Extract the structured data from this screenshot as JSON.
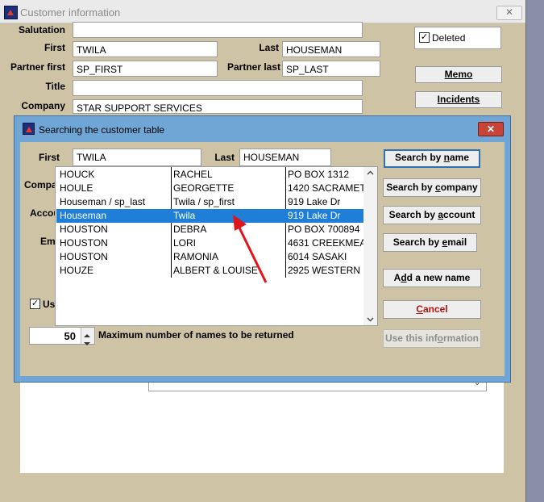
{
  "bg_window": {
    "title": "Customer information",
    "close": "✕",
    "labels": {
      "salutation": "Salutation",
      "first": "First",
      "last": "Last",
      "partner_first": "Partner first",
      "partner_last": "Partner last",
      "title": "Title",
      "company": "Company",
      "company_partial": "Compa",
      "account_partial": "Accou",
      "email_partial": "Em",
      "use_partial": "Us"
    },
    "values": {
      "salutation": "",
      "first": "TWILA",
      "last": "HOUSEMAN",
      "partner_first": "SP_FIRST",
      "partner_last": "SP_LAST",
      "title": "",
      "company": "STAR SUPPORT SERVICES"
    },
    "deleted_label": "Deleted",
    "deleted_checked": "✓",
    "memo_button": "Memo",
    "incidents_button": "Incidents"
  },
  "dialog": {
    "title": "Searching the customer table",
    "close": "✕",
    "first_label": "First",
    "first_value": "TWILA",
    "last_label": "Last",
    "last_value": "HOUSEMAN",
    "results": [
      {
        "last": "HOUCK",
        "first": "RACHEL",
        "address": "PO BOX 1312"
      },
      {
        "last": "HOULE",
        "first": "GEORGETTE",
        "address": "1420 SACRAMET"
      },
      {
        "last": "Houseman / sp_last",
        "first": "Twila / sp_first",
        "address": "919 Lake Dr"
      },
      {
        "last": "Houseman",
        "first": "Twila",
        "address": "919 Lake Dr"
      },
      {
        "last": "HOUSTON",
        "first": "DEBRA",
        "address": "PO BOX 700894"
      },
      {
        "last": "HOUSTON",
        "first": "LORI",
        "address": "4631 CREEKMEA"
      },
      {
        "last": "HOUSTON",
        "first": "RAMONIA",
        "address": "6014 SASAKI"
      },
      {
        "last": "HOUZE",
        "first": "ALBERT & LOUISE",
        "address": "2925 WESTERN"
      }
    ],
    "selected_index": 3,
    "max_names_value": "50",
    "max_names_label": "Maximum number of names to be returned",
    "use_checked": "✓",
    "buttons": {
      "search_by_name": {
        "pre": "Search by ",
        "key": "n",
        "post": "ame"
      },
      "search_by_company": {
        "pre": "Search by ",
        "key": "c",
        "post": "ompany"
      },
      "search_by_account": {
        "pre": "Search by ",
        "key": "a",
        "post": "ccount"
      },
      "search_by_email": {
        "pre": "Search by ",
        "key": "e",
        "post": "mail"
      },
      "add_new_name": {
        "pre": "A",
        "key": "d",
        "post": "d a new name"
      },
      "cancel": {
        "pre": "",
        "key": "C",
        "post": "ancel"
      },
      "use_this_info": {
        "pre": "Use this inf",
        "key": "o",
        "post": "rmation"
      }
    },
    "accent_colors": {
      "selection": "#1f7fd8",
      "arrow": "#e0141b",
      "dialog_frame": "#6fa6d6"
    }
  }
}
